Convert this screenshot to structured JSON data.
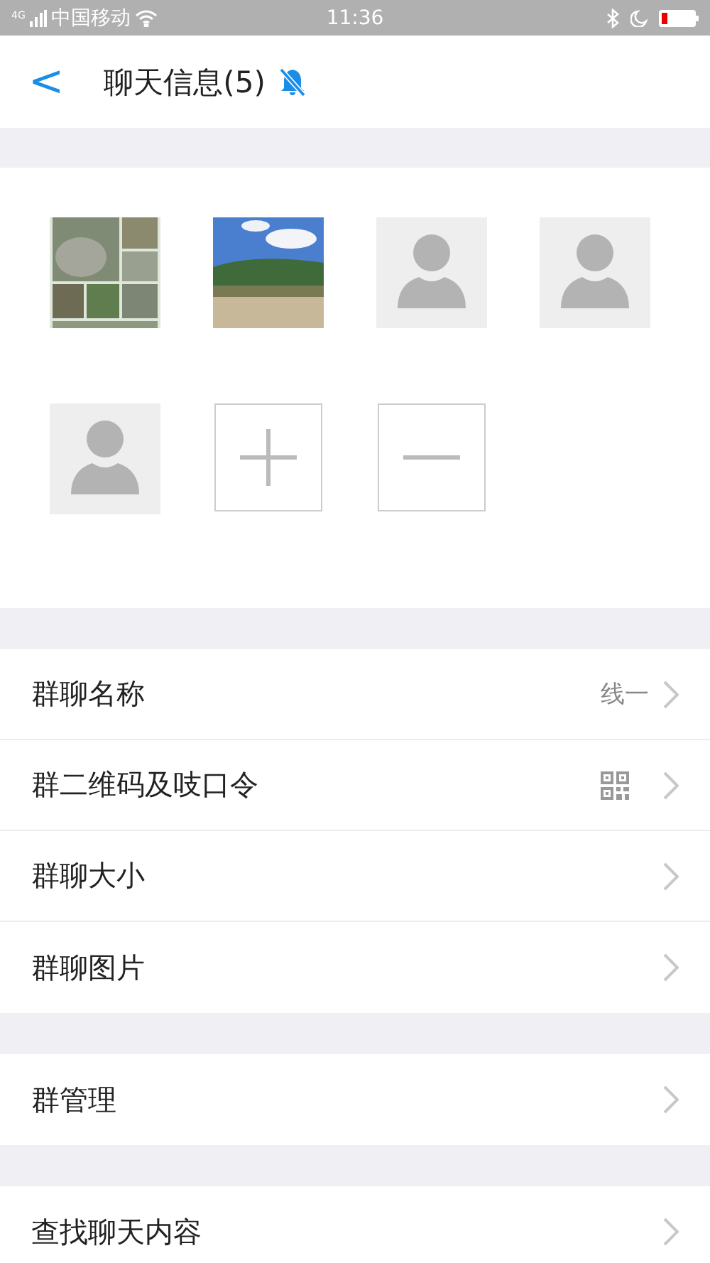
{
  "status_bar": {
    "network": "4G",
    "carrier": "中国移动",
    "time": "11:36"
  },
  "header": {
    "back": "<",
    "title": "聊天信息(5)",
    "muted": true
  },
  "members": [
    {
      "kind": "picture"
    },
    {
      "kind": "picture"
    },
    {
      "kind": "default"
    },
    {
      "kind": "default"
    },
    {
      "kind": "default"
    },
    {
      "kind": "add"
    },
    {
      "kind": "remove"
    }
  ],
  "groups": [
    [
      {
        "label": "群聊名称",
        "value": "线一",
        "kind": "text"
      },
      {
        "label": "群二维码及吱口令",
        "kind": "qr"
      },
      {
        "label": "群聊大小",
        "kind": "plain"
      },
      {
        "label": "群聊图片",
        "kind": "plain"
      }
    ],
    [
      {
        "label": "群管理",
        "kind": "plain"
      }
    ],
    [
      {
        "label": "查找聊天内容",
        "kind": "plain"
      }
    ]
  ]
}
